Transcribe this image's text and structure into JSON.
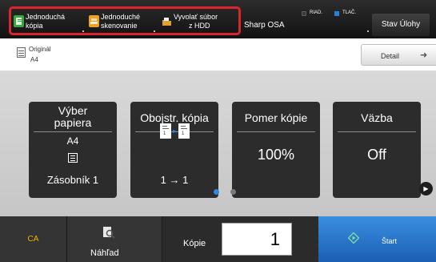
{
  "topbar": {
    "shortcuts": [
      {
        "line1": "Jednoduchá",
        "line2": "kópia",
        "icon": "copy-icon",
        "color": "#3aa640"
      },
      {
        "line1": "Jednoduché",
        "line2": "skenovanie",
        "icon": "scan-icon",
        "color": "#f0a020"
      },
      {
        "line1": "Vyvolať súbor",
        "line2": "z HDD",
        "icon": "folder-icon",
        "color": "#e0a030"
      }
    ],
    "highlight_color": "#d7262e",
    "sharp_osa": "Sharp OSA",
    "status": {
      "riad": "RIAD.",
      "tlac": "TLAČ.",
      "riad_color": "#3a3a3a",
      "tlac_color": "#2c7fd8"
    },
    "job_status_label": "Stav Úlohy"
  },
  "original": {
    "label": "Originál",
    "size": "A4"
  },
  "detail": {
    "label": "Detail"
  },
  "tiles": {
    "paper": {
      "title_line1": "Výber",
      "title_line2": "papiera",
      "size": "A4",
      "tray": "Zásobník 1"
    },
    "duplex": {
      "title": "Obojstr. kópia",
      "value": "1 → 1"
    },
    "ratio": {
      "title": "Pomer kópie",
      "value": "100%"
    },
    "binding": {
      "title": "Väzba",
      "value": "Off"
    }
  },
  "pagination": {
    "current": 1,
    "total": 2,
    "active_color": "#2f86e0",
    "inactive_color": "#7a7a7a"
  },
  "bottombar": {
    "ca_label": "CA",
    "preview_label": "Náhľad",
    "copies_label": "Kópie",
    "copies_value": "1",
    "start_label": "Štart",
    "start_color": "#2b7ad0"
  }
}
